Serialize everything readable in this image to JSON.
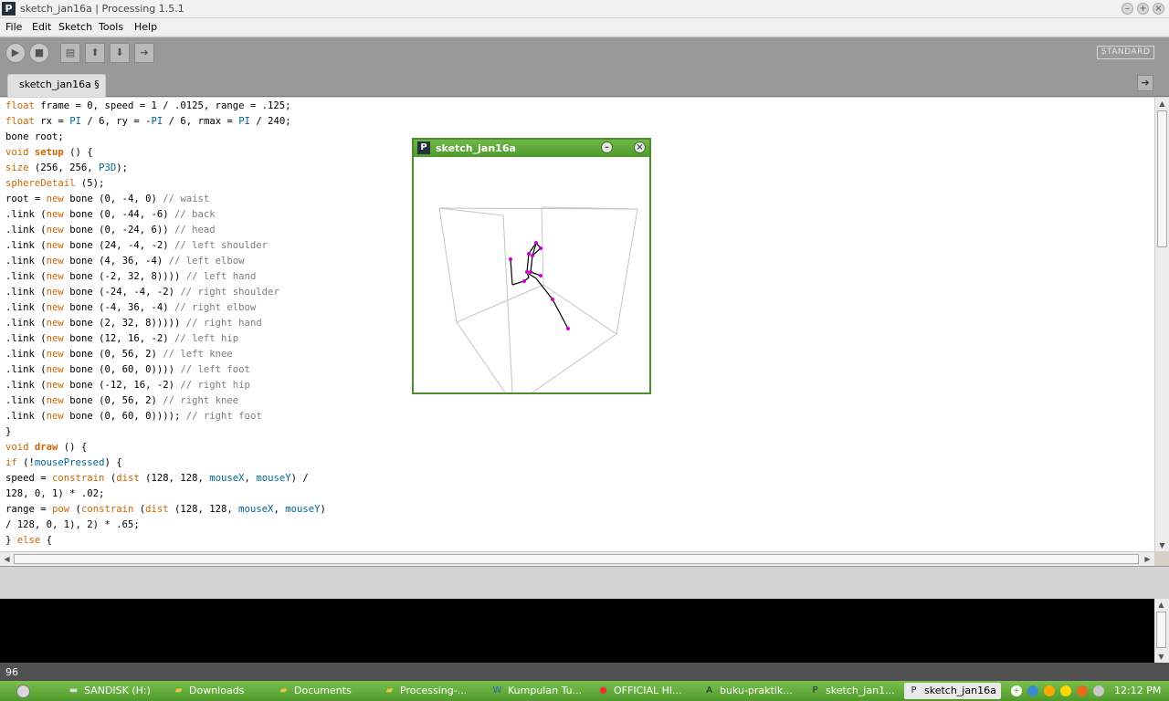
{
  "window": {
    "title": "sketch_jan16a | Processing 1.5.1",
    "app_icon": "P"
  },
  "menu": [
    "File",
    "Edit",
    "Sketch",
    "Tools",
    "Help"
  ],
  "toolbar": {
    "run_icon": "play-icon",
    "stop_icon": "stop-icon",
    "new_icon": "new-file-icon",
    "open_icon": "open-arrow-icon",
    "save_icon": "save-arrow-icon",
    "export_icon": "export-icon",
    "mode": "STANDARD"
  },
  "tab": {
    "label": "sketch_jan16a §"
  },
  "code_lines": [
    "float frame = 0, speed = 1 / .0125, range = .125;",
    "float rx = PI / 6, ry = -PI / 6, rmax = PI / 240;",
    "bone root;",
    "void setup () {",
    "size (256, 256, P3D);",
    "sphereDetail (5);",
    "root = new bone (0, -4, 0) // waist",
    ".link (new bone (0, -44, -6) // back",
    ".link (new bone (0, -24, 6)) // head",
    ".link (new bone (24, -4, -2) // left shoulder",
    ".link (new bone (4, 36, -4) // left elbow",
    ".link (new bone (-2, 32, 8)))) // left hand",
    ".link (new bone (-24, -4, -2) // right shoulder",
    ".link (new bone (-4, 36, -4) // right elbow",
    ".link (new bone (2, 32, 8))))) // right hand",
    ".link (new bone (12, 16, -2) // left hip",
    ".link (new bone (0, 56, 2) // left knee",
    ".link (new bone (0, 60, 0)))) // left foot",
    ".link (new bone (-12, 16, -2) // right hip",
    ".link (new bone (0, 56, 2) // right knee",
    ".link (new bone (0, 60, 0)))); // right foot",
    "}",
    "void draw () {",
    "if (!mousePressed) {",
    "speed = constrain (dist (128, 128, mouseX, mouseY) /",
    "128, 0, 1) * .02;",
    "range = pow (constrain (dist (128, 128, mouseX, mouseY)",
    "/ 128, 0, 1), 2) * .65;",
    "} else {"
  ],
  "status": {
    "line_number": "96"
  },
  "sketch_window": {
    "title": "sketch_jan16a",
    "app_icon": "P",
    "minimize_icon": "minimize-icon",
    "close_icon": "close-icon"
  },
  "taskbar": {
    "items": [
      {
        "label": "SANDISK (H:)",
        "icon": "drive-icon"
      },
      {
        "label": "Downloads",
        "icon": "folder-icon"
      },
      {
        "label": "Documents",
        "icon": "folder-icon"
      },
      {
        "label": "Processing-...",
        "icon": "folder-icon"
      },
      {
        "label": "Kumpulan Tu...",
        "icon": "word-icon"
      },
      {
        "label": "OFFICIAL HI...",
        "icon": "chrome-icon"
      },
      {
        "label": "buku-praktik...",
        "icon": "pdf-icon"
      },
      {
        "label": "sketch_jan1...",
        "icon": "processing-icon"
      },
      {
        "label": "sketch_jan16a",
        "icon": "processing-icon"
      }
    ],
    "clock": "12:12 PM"
  },
  "colors": {
    "keyword": "#cc6600",
    "constant": "#006699",
    "comment": "#7e7e7e",
    "sketch_frame": "#4e8c2e",
    "joint": "#cc00cc"
  }
}
